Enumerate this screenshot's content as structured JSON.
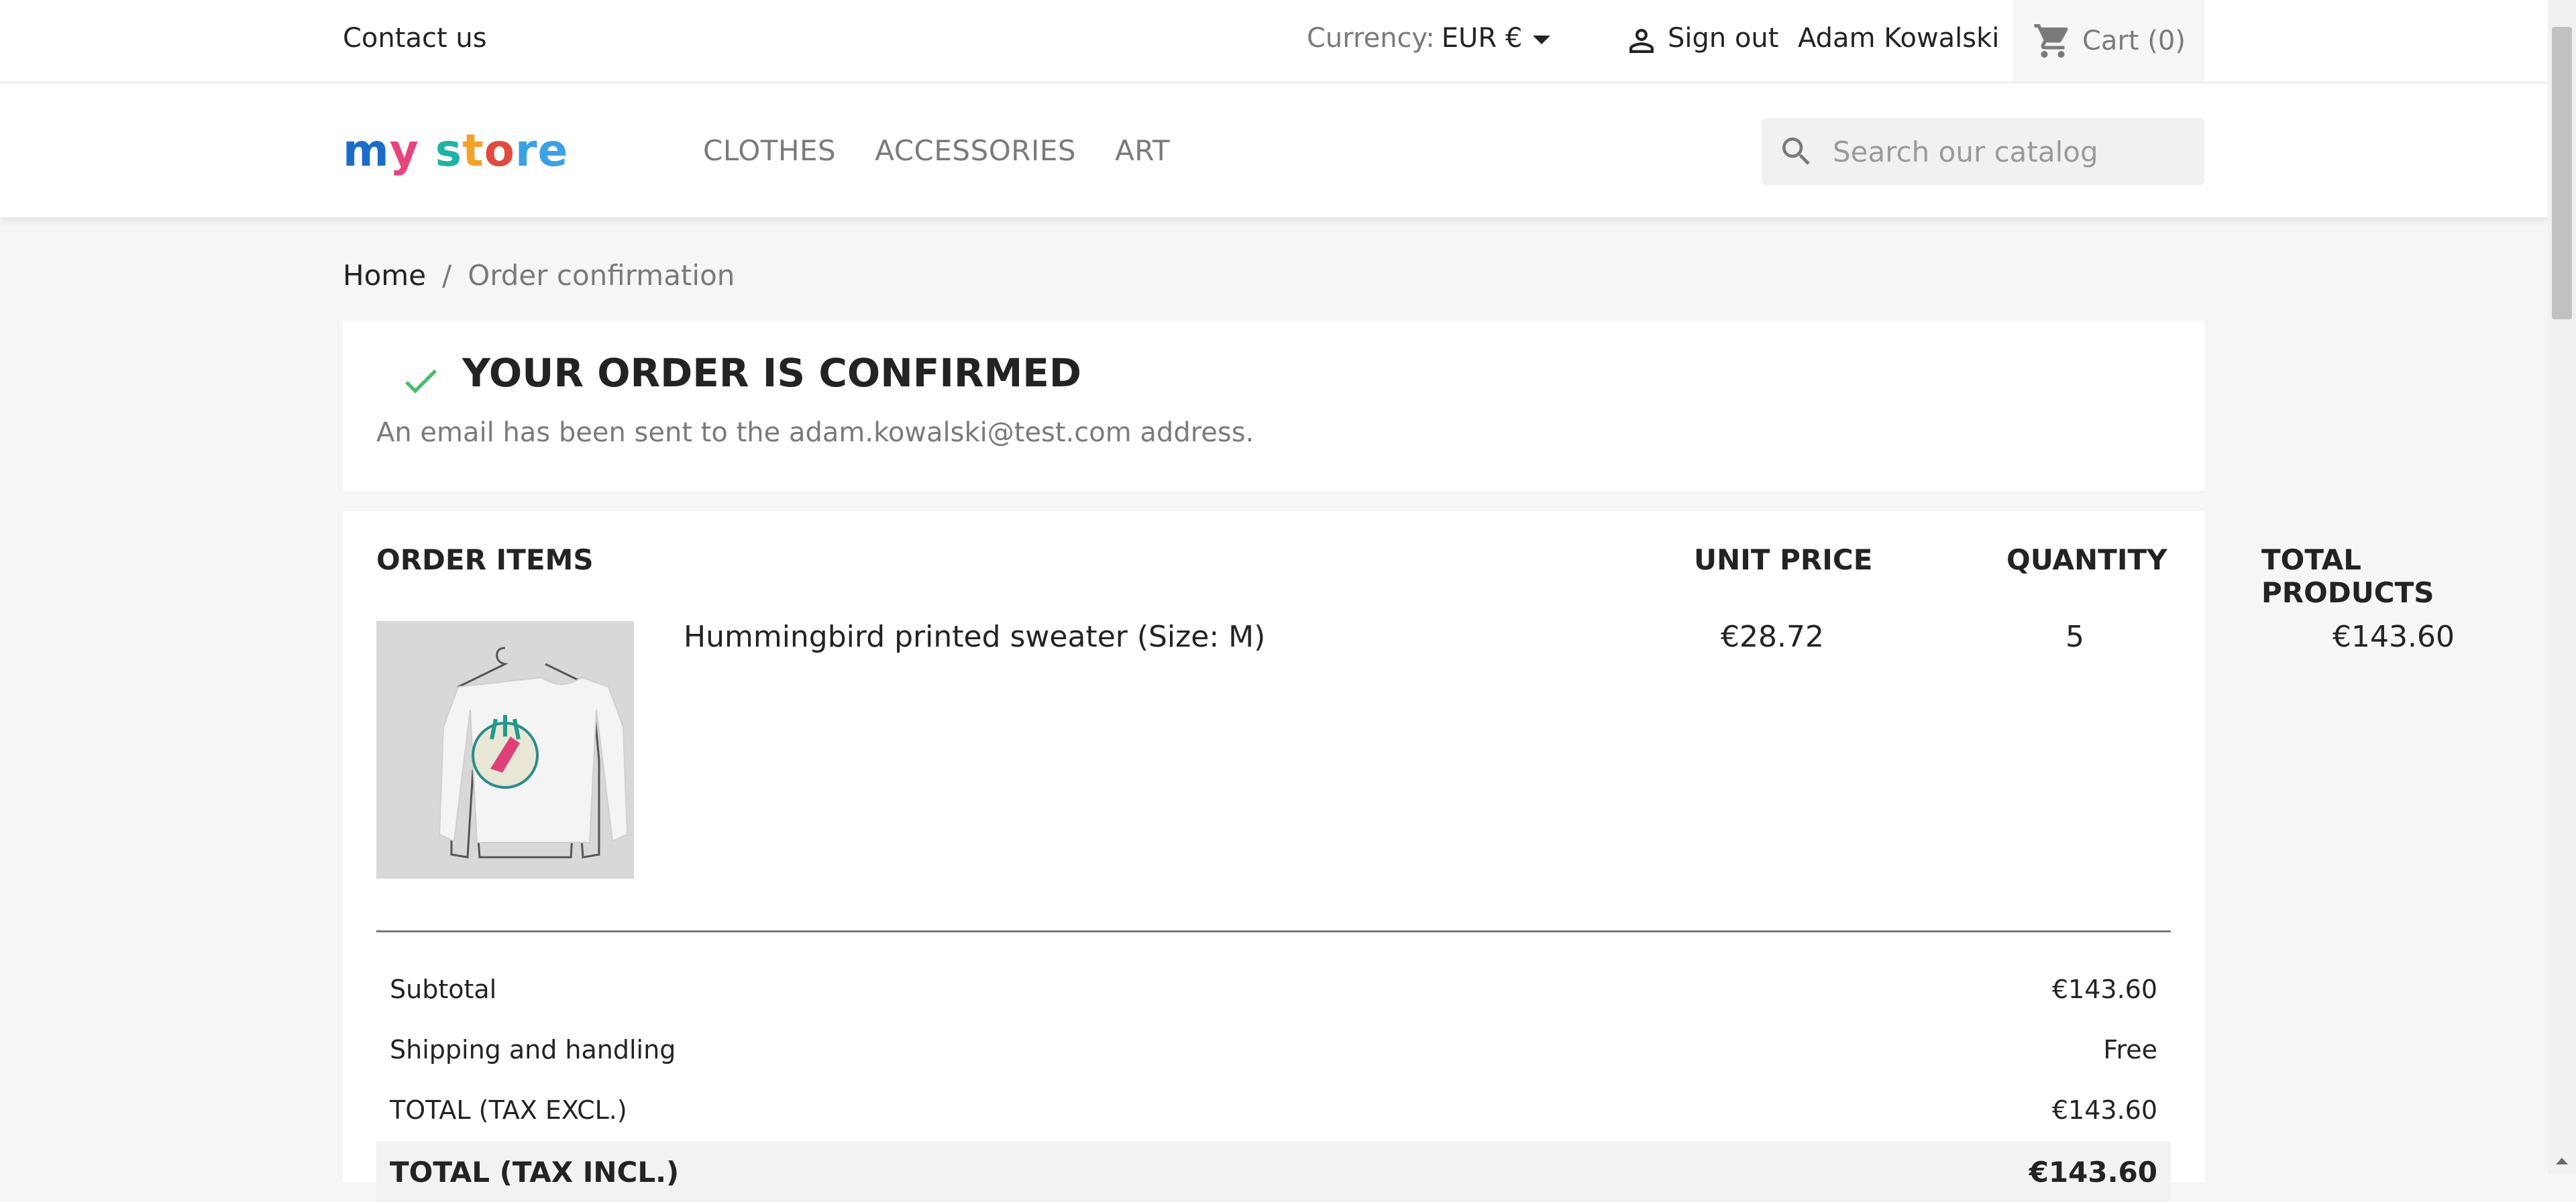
{
  "topnav": {
    "contact": "Contact us",
    "currency_label": "Currency:",
    "currency_value": "EUR €",
    "sign_out": "Sign out",
    "user_name": "Adam Kowalski",
    "cart": "Cart (0)"
  },
  "header": {
    "logo": {
      "part1": "m",
      "part2": "y",
      "part3": " s",
      "part4": "t",
      "part5": "o",
      "part6": "re"
    },
    "menu": [
      "CLOTHES",
      "ACCESSORIES",
      "ART"
    ],
    "search_placeholder": "Search our catalog"
  },
  "breadcrumb": {
    "home": "Home",
    "separator": "/",
    "current": "Order confirmation"
  },
  "confirmation": {
    "title": "YOUR ORDER IS CONFIRMED",
    "message": "An email has been sent to the adam.kowalski@test.com address."
  },
  "order": {
    "headers": {
      "items": "ORDER ITEMS",
      "unit_price": "UNIT PRICE",
      "quantity": "QUANTITY",
      "total": "TOTAL PRODUCTS"
    },
    "items": [
      {
        "name": "Hummingbird printed sweater (Size: M)",
        "unit_price": "€28.72",
        "quantity": "5",
        "total": "€143.60"
      }
    ],
    "summary": [
      {
        "label": "Subtotal",
        "value": "€143.60"
      },
      {
        "label": "Shipping and handling",
        "value": "Free"
      },
      {
        "label": "TOTAL (TAX EXCL.)",
        "value": "€143.60"
      },
      {
        "label": "TOTAL (TAX INCL.)",
        "value": "€143.60"
      }
    ]
  },
  "colors": {
    "accent_check": "#4cbb6c",
    "background": "#f6f6f6"
  }
}
